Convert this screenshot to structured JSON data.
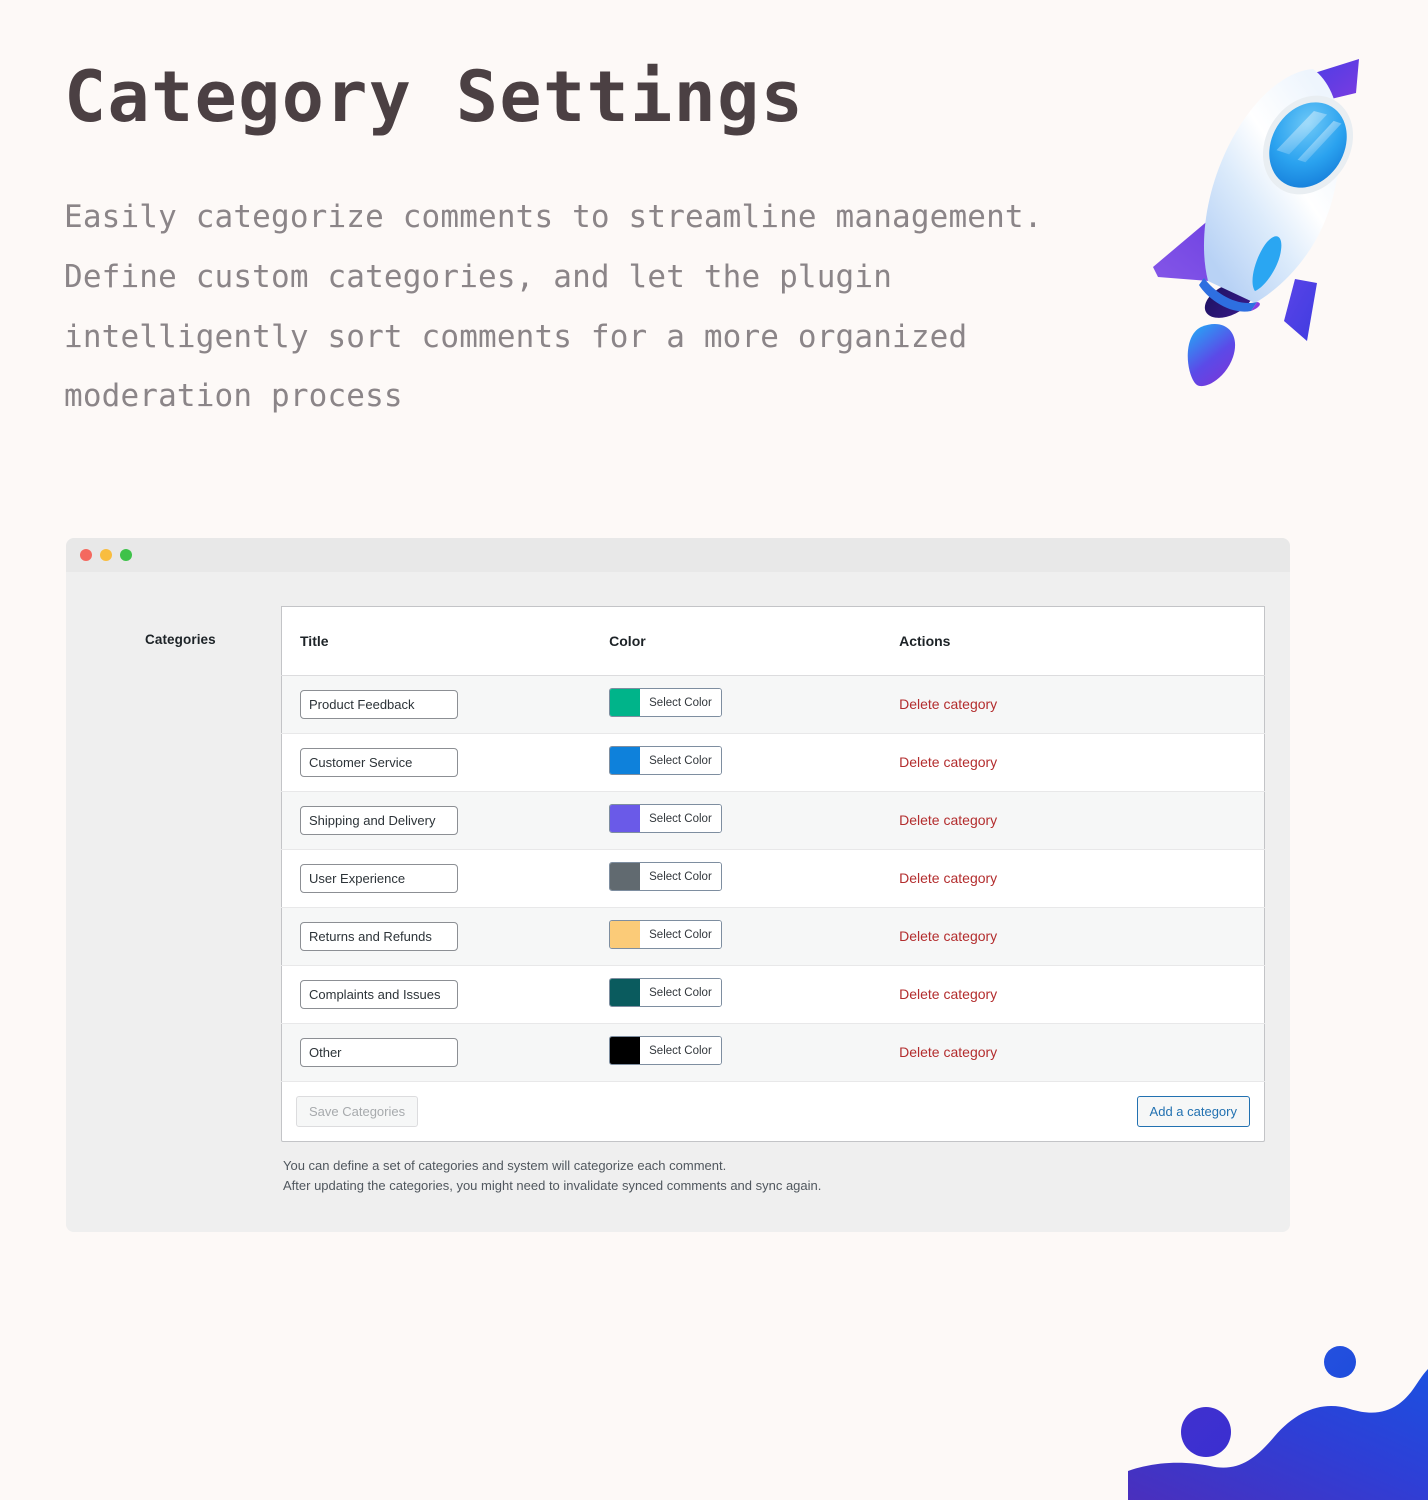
{
  "hero": {
    "title": "Category Settings",
    "subtitle": "Easily categorize comments to streamline management. Define custom categories, and let the plugin intelligently sort comments for a more organized moderation process"
  },
  "window": {
    "dots": [
      "close-red",
      "minimize-yellow",
      "maximize-green"
    ],
    "side_label": "Categories"
  },
  "table": {
    "headers": {
      "title": "Title",
      "color": "Color",
      "actions": "Actions"
    },
    "select_color_label": "Select Color",
    "delete_label": "Delete category",
    "rows": [
      {
        "title": "Product Feedback",
        "color": "#00b48a",
        "delete": "Delete category"
      },
      {
        "title": "Customer Service",
        "color": "#0e81db",
        "delete": "Delete category"
      },
      {
        "title": "Shipping and Delivery",
        "color": "#6a5ae8",
        "delete": "Delete category"
      },
      {
        "title": "User Experience",
        "color": "#616a70",
        "delete": "Delete category"
      },
      {
        "title": "Returns and Refunds",
        "color": "#fbcb78",
        "delete": "Delete category"
      },
      {
        "title": "Complaints and Issues",
        "color": "#0a5b5e",
        "delete": "Delete category"
      },
      {
        "title": "Other",
        "color": "#000000",
        "delete": "Delete category"
      }
    ]
  },
  "footer": {
    "save_label": "Save Categories",
    "add_label": "Add a category",
    "help_line_1": "You can define a set of categories and system will categorize each comment.",
    "help_line_2": "After updating the categories, you might need to invalidate synced comments and sync again."
  },
  "decor": {
    "rocket_icon": "rocket-illustration",
    "blob_icon": "wave-blob-illustration",
    "accent_blue": "#1b50e0",
    "accent_purple": "#4a2fbd"
  }
}
